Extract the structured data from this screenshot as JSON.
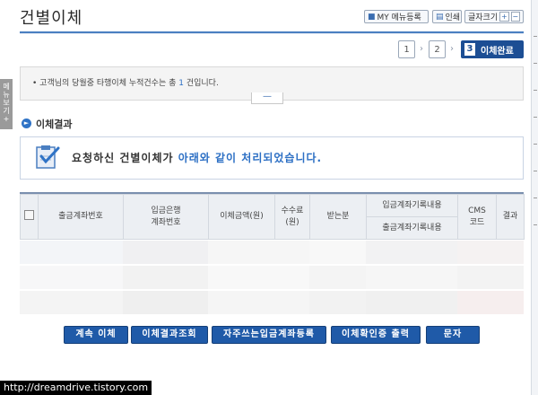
{
  "header": {
    "title": "건별이체",
    "my_menu_label": "MY 메뉴등록",
    "print_label": "인쇄",
    "font_size_label": "글자크기",
    "font_plus": "+",
    "font_minus": "−"
  },
  "steps": {
    "step1": "1",
    "step2": "2",
    "step3_num": "3",
    "step3_label": "이체완료"
  },
  "notice": {
    "prefix": "• 고객님의 당월중 타행이체 누적건수는 총 ",
    "count": "1",
    "suffix": " 건입니다.",
    "toggle": "—"
  },
  "section": {
    "title": "이체결과",
    "result_prefix": "요청하신 건별이체가 ",
    "result_highlight": "아래와 같이 처리되었습니다."
  },
  "table": {
    "col_account": "출금계좌번호",
    "col_bank_line1": "입금은행",
    "col_bank_line2": "계좌번호",
    "col_amount": "이체금액(원)",
    "col_fee_line1": "수수료",
    "col_fee_line2": "(원)",
    "col_recipient": "받는분",
    "col_memo_in": "입금계좌기록내용",
    "col_memo_out": "출금계좌기록내용",
    "col_cms_line1": "CMS",
    "col_cms_line2": "코드",
    "col_result": "결과"
  },
  "actions": {
    "continue": "계속 이체",
    "inquiry": "이체결과조회",
    "register": "자주쓰는입금계좌등록",
    "confirm_print": "이체확인증 출력",
    "sms": "문자"
  },
  "side": {
    "quick_menu": "메뉴보기",
    "quick_plus": "+"
  },
  "footer": {
    "url": "http://dreamdrive.tistory.com"
  },
  "colors": {
    "accent": "#1f5aa8",
    "highlight": "#2c6fc4"
  }
}
